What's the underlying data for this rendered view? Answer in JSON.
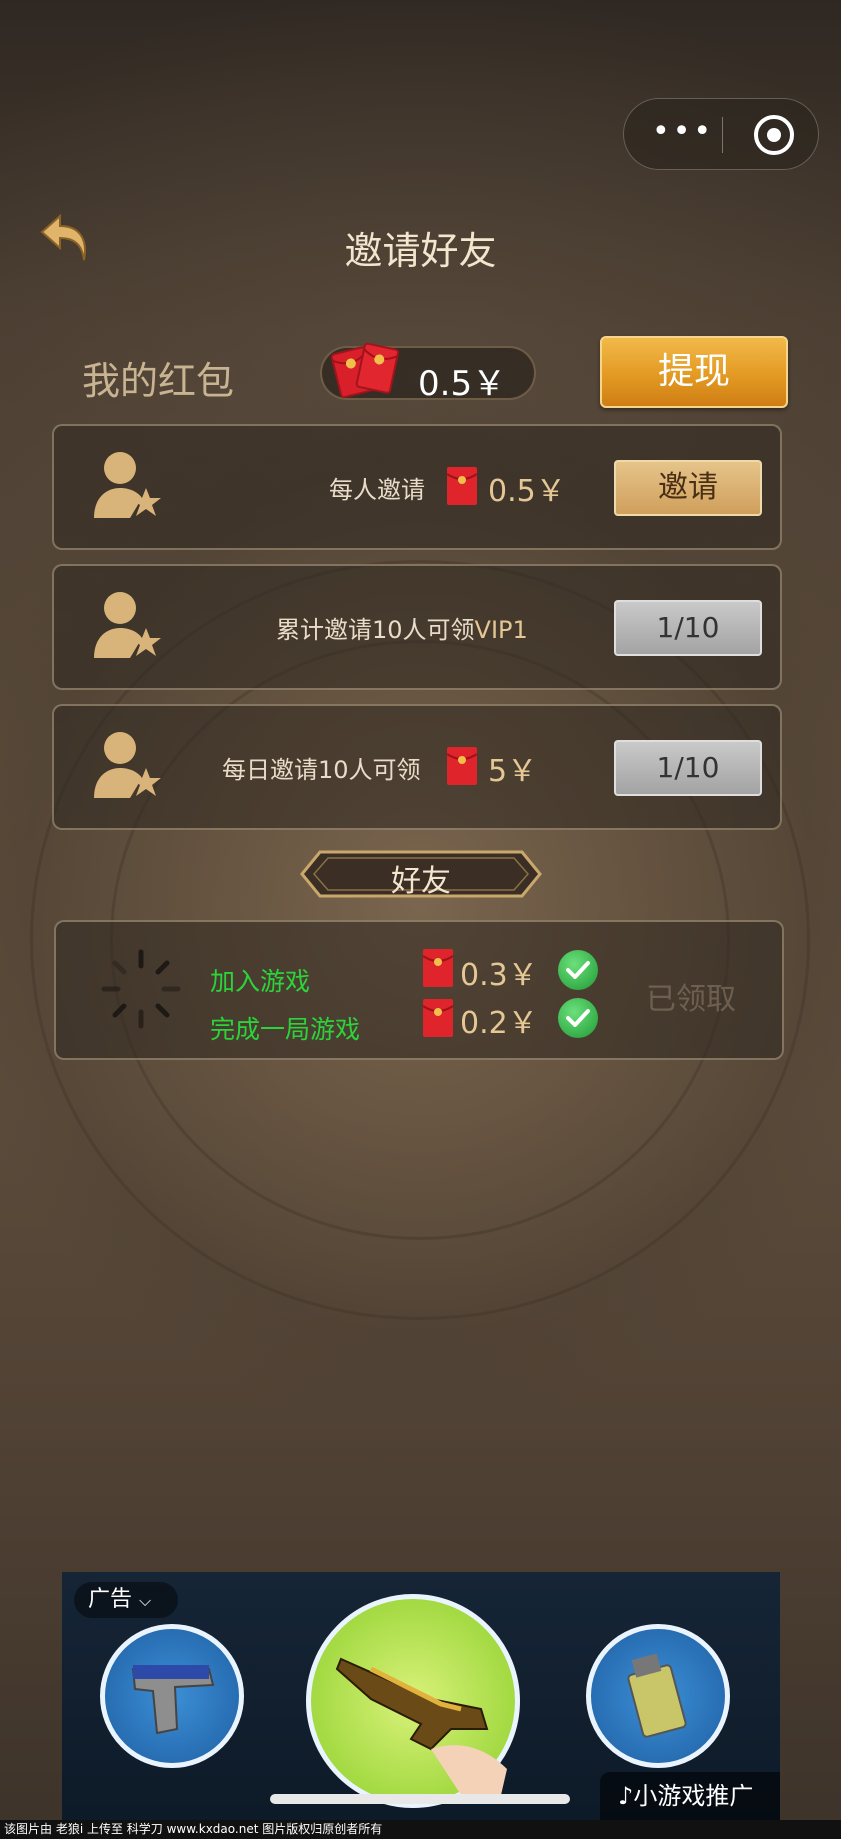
{
  "header": {
    "title": "邀请好友"
  },
  "capsule": {
    "more_label": "•••"
  },
  "wallet": {
    "label": "我的红包",
    "amount": "0.5￥",
    "withdraw_label": "提现"
  },
  "cards": [
    {
      "text": "每人邀请",
      "amount": "0.5￥",
      "button": "邀请"
    },
    {
      "text": "累计邀请10人可领",
      "vip": "VIP1",
      "button": "1/10"
    },
    {
      "text": "每日邀请10人可领",
      "amount": "5￥",
      "button": "1/10"
    }
  ],
  "friends": {
    "title": "好友",
    "tasks": [
      {
        "label": "加入游戏",
        "amount": "0.3￥"
      },
      {
        "label": "完成一局游戏",
        "amount": "0.2￥"
      }
    ],
    "status": "已领取"
  },
  "ad": {
    "tag": "广告",
    "promo": "小游戏推广"
  },
  "footer": {
    "text": "该图片由 老狼i 上传至 科学刀 www.kxdao.net 图片版权归原创者所有"
  }
}
